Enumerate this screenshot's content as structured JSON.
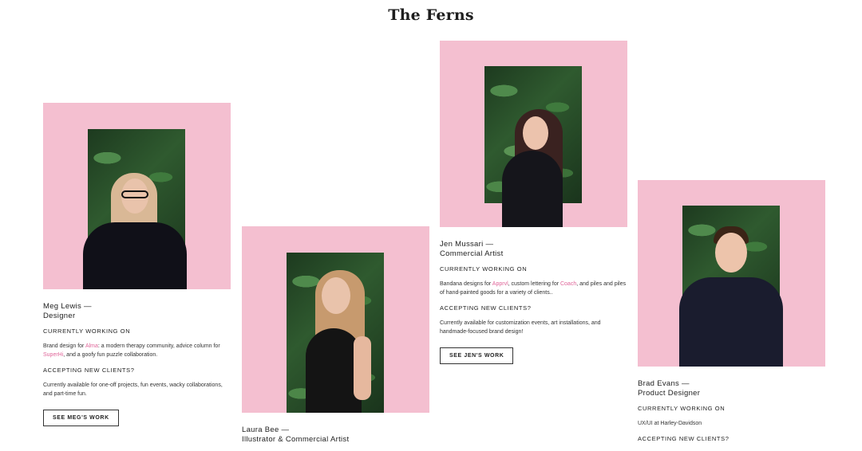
{
  "page": {
    "title": "The Ferns"
  },
  "members": [
    {
      "name": "Meg Lewis —\nDesigner",
      "working_label": "CURRENTLY WORKING ON",
      "working_parts": [
        "Brand design for ",
        "Alma",
        ": a modern therapy community, advice column for ",
        "SuperHi",
        ", and a goofy fun puzzle collaboration."
      ],
      "clients_label": "ACCEPTING NEW CLIENTS?",
      "clients_text": "Currently available for one-off projects, fun events, wacky collaborations, and part-time fun.",
      "cta": "SEE MEG'S WORK"
    },
    {
      "name": "Laura Bee —\nIllustrator & Commercial Artist"
    },
    {
      "name": "Jen Mussari —\nCommercial Artist",
      "working_label": "CURRENTLY WORKING ON",
      "working_parts": [
        "Bandana designs for ",
        "Apprvl",
        ", custom lettering for ",
        "Coach",
        ", and piles and piles of hand-painted goods for a variety of clients.."
      ],
      "clients_label": "ACCEPTING NEW CLIENTS?",
      "clients_text": "Currently available for customization events, art installations, and handmade-focused brand design!",
      "cta": "SEE JEN'S WORK"
    },
    {
      "name": "Brad Evans —\nProduct Designer",
      "working_label": "CURRENTLY WORKING ON",
      "working_text": "UX/UI at Harley-Davidson",
      "clients_label": "ACCEPTING NEW CLIENTS?"
    }
  ],
  "colors": {
    "photo_background": "#f4bfd0",
    "link": "#e0669a",
    "text": "#222222"
  }
}
